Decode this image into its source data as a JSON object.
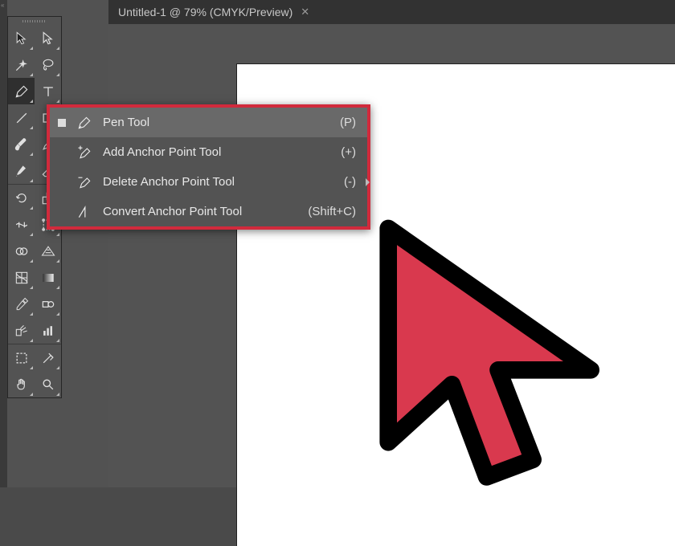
{
  "document": {
    "tab_title": "Untitled-1 @ 79% (CMYK/Preview)"
  },
  "flyout": {
    "items": [
      {
        "label": "Pen Tool",
        "shortcut": "(P)"
      },
      {
        "label": "Add Anchor Point Tool",
        "shortcut": "(+)"
      },
      {
        "label": "Delete Anchor Point Tool",
        "shortcut": "(-)"
      },
      {
        "label": "Convert Anchor Point Tool",
        "shortcut": "(Shift+C)"
      }
    ]
  },
  "colors": {
    "highlight_border": "#d12a3c",
    "cursor_fill": "#d9394e"
  }
}
